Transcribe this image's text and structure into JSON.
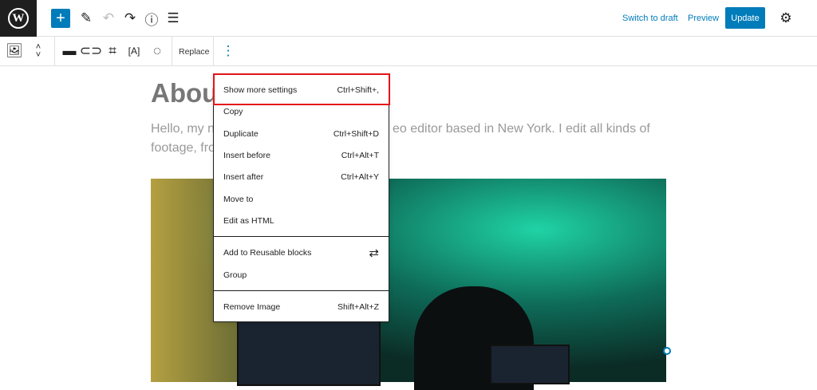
{
  "topbar": {
    "switch_to_draft": "Switch to draft",
    "preview": "Preview",
    "update": "Update"
  },
  "toolbar": {
    "replace": "Replace"
  },
  "content": {
    "heading": "About",
    "para_line1_left": "Hello, my n",
    "para_line1_right": "eo editor based in New York. I edit all kinds of",
    "para_line2_left": "footage, fro"
  },
  "menu": {
    "items": [
      {
        "label": "Show more settings",
        "shortcut": "Ctrl+Shift+,"
      },
      {
        "label": "Copy",
        "shortcut": ""
      },
      {
        "label": "Duplicate",
        "shortcut": "Ctrl+Shift+D"
      },
      {
        "label": "Insert before",
        "shortcut": "Ctrl+Alt+T"
      },
      {
        "label": "Insert after",
        "shortcut": "Ctrl+Alt+Y"
      },
      {
        "label": "Move to",
        "shortcut": ""
      },
      {
        "label": "Edit as HTML",
        "shortcut": ""
      },
      {
        "label": "Add to Reusable blocks",
        "shortcut": ""
      },
      {
        "label": "Group",
        "shortcut": ""
      },
      {
        "label": "Remove Image",
        "shortcut": "Shift+Alt+Z"
      }
    ]
  },
  "colors": {
    "accent": "#007cba",
    "highlight": "#e5141b"
  }
}
